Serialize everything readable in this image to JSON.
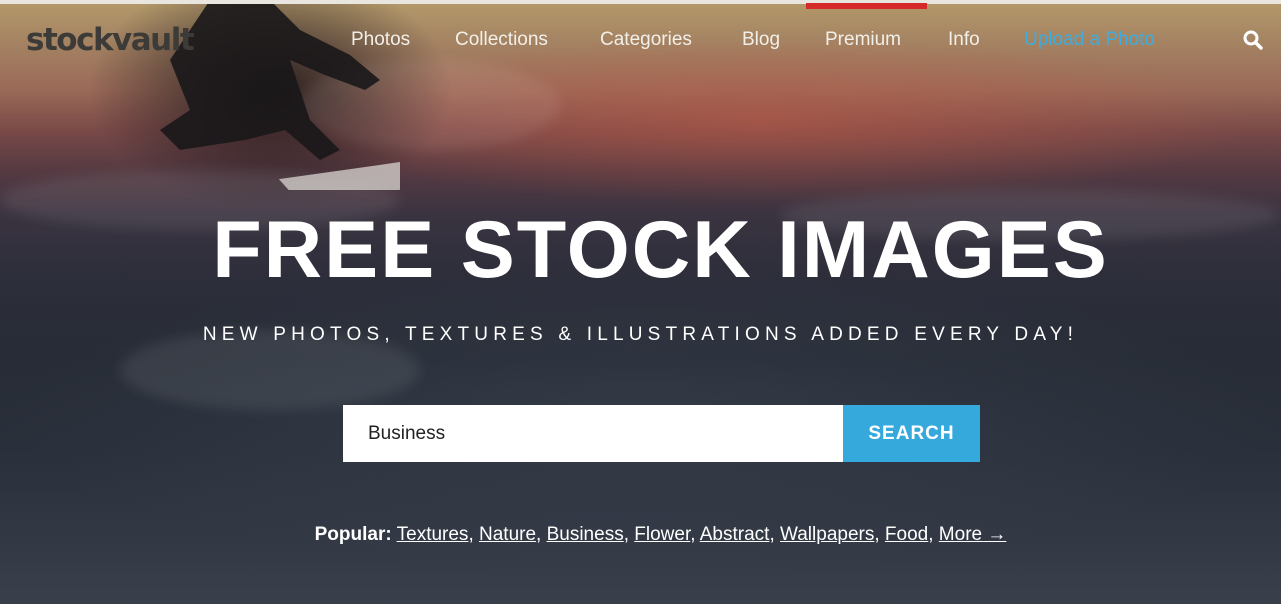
{
  "logo": {
    "text": "stockvault"
  },
  "nav": {
    "items": [
      {
        "label": "Photos"
      },
      {
        "label": "Collections"
      },
      {
        "label": "Categories"
      },
      {
        "label": "Blog"
      },
      {
        "label": "Premium"
      },
      {
        "label": "Info"
      },
      {
        "label": "Upload a Photo"
      }
    ],
    "active_indicator_color": "#d42a2a",
    "upload_color": "#3aaee0"
  },
  "hero": {
    "title": "FREE STOCK IMAGES",
    "subtitle": "NEW PHOTOS, TEXTURES & ILLUSTRATIONS ADDED EVERY DAY!"
  },
  "search": {
    "value": "Business",
    "button_label": "SEARCH",
    "button_color": "#35a9dc",
    "icon": "search-icon"
  },
  "popular": {
    "label": "Popular:",
    "links": [
      {
        "label": "Textures"
      },
      {
        "label": "Nature"
      },
      {
        "label": "Business"
      },
      {
        "label": "Flower"
      },
      {
        "label": "Abstract"
      },
      {
        "label": "Wallpapers"
      },
      {
        "label": "Food"
      },
      {
        "label": "More →"
      }
    ]
  }
}
